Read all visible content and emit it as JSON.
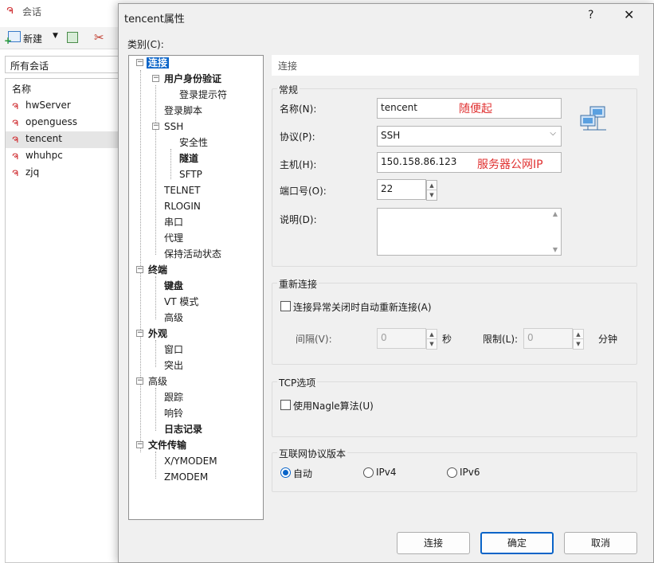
{
  "background_window": {
    "title": "会话",
    "toolbar": {
      "new_label": "新建"
    },
    "all_sessions_label": "所有会话",
    "list_header": "名称",
    "sessions": [
      "hwServer",
      "openguess",
      "tencent",
      "whuhpc",
      "zjq"
    ],
    "selected_session": "tencent"
  },
  "dialog": {
    "title": "tencent属性",
    "help_label": "?",
    "close_label": "✕",
    "category_label": "类别(C):",
    "tree": [
      {
        "label": "连接"
      },
      {
        "label": "用户身份验证"
      },
      {
        "label": "登录提示符"
      },
      {
        "label": "登录脚本"
      },
      {
        "label": "SSH"
      },
      {
        "label": "安全性"
      },
      {
        "label": "隧道"
      },
      {
        "label": "SFTP"
      },
      {
        "label": "TELNET"
      },
      {
        "label": "RLOGIN"
      },
      {
        "label": "串口"
      },
      {
        "label": "代理"
      },
      {
        "label": "保持活动状态"
      },
      {
        "label": "终端"
      },
      {
        "label": "键盘"
      },
      {
        "label": "VT 模式"
      },
      {
        "label": "高级"
      },
      {
        "label": "外观"
      },
      {
        "label": "窗口"
      },
      {
        "label": "突出"
      },
      {
        "label": "高级"
      },
      {
        "label": "跟踪"
      },
      {
        "label": "响铃"
      },
      {
        "label": "日志记录"
      },
      {
        "label": "文件传输"
      },
      {
        "label": "X/YMODEM"
      },
      {
        "label": "ZMODEM"
      }
    ],
    "panel_header": "连接",
    "general": {
      "legend": "常规",
      "name_label": "名称(N):",
      "name_value": "tencent",
      "name_note": "随便起",
      "protocol_label": "协议(P):",
      "protocol_value": "SSH",
      "host_label": "主机(H):",
      "host_value": "150.158.86.123",
      "host_note": "服务器公网IP",
      "port_label": "端口号(O):",
      "port_value": "22",
      "desc_label": "说明(D):",
      "desc_value": ""
    },
    "reconnect": {
      "legend": "重新连接",
      "checkbox_label": "连接异常关闭时自动重新连接(A)",
      "interval_label": "间隔(V):",
      "interval_value": "0",
      "interval_unit": "秒",
      "limit_label": "限制(L):",
      "limit_value": "0",
      "limit_unit": "分钟"
    },
    "tcp": {
      "legend": "TCP选项",
      "nagle_label": "使用Nagle算法(U)"
    },
    "ip_version": {
      "legend": "互联网协议版本",
      "options": [
        "自动",
        "IPv4",
        "IPv6"
      ],
      "selected": "自动"
    },
    "buttons": {
      "connect": "连接",
      "ok": "确定",
      "cancel": "取消"
    },
    "colors": {
      "accent": "#0a64c8",
      "annotation": "#e03030"
    }
  }
}
